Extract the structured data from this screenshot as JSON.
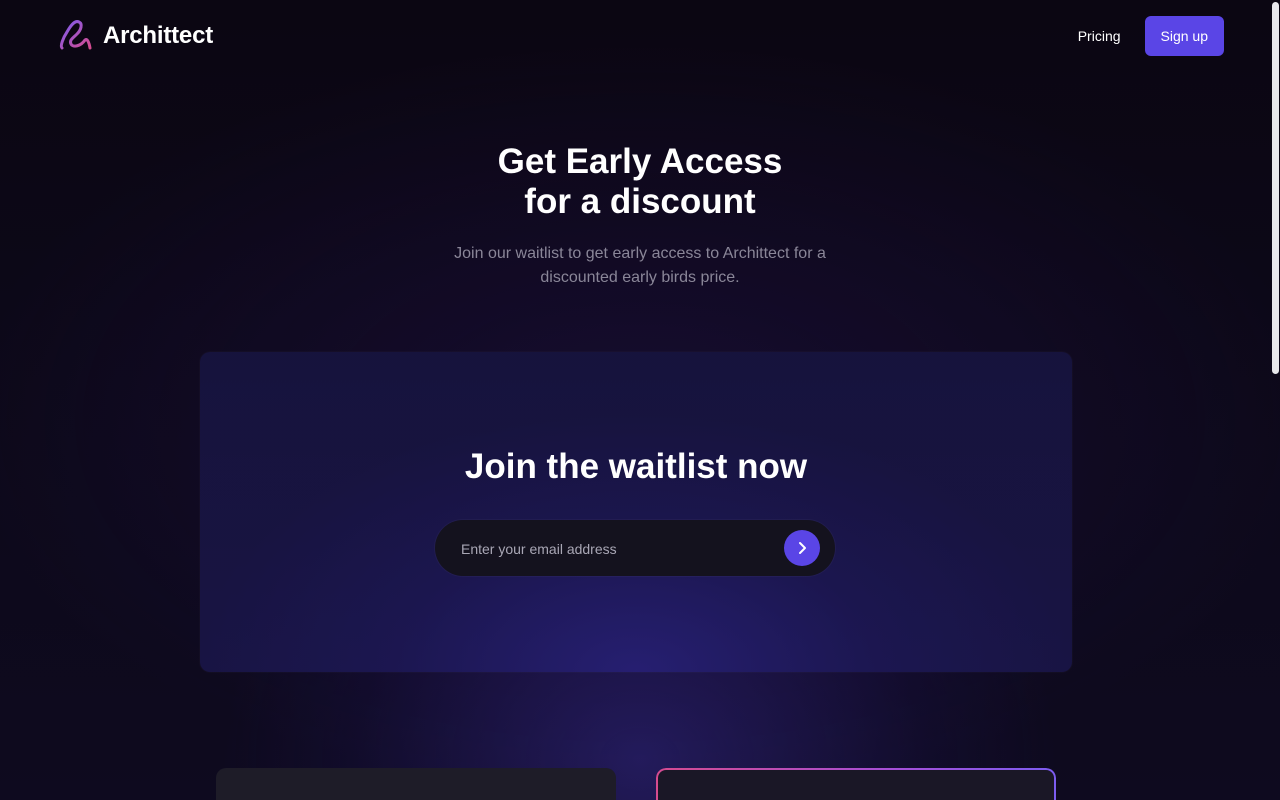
{
  "header": {
    "brand_name": "Archittect",
    "nav": {
      "pricing_label": "Pricing",
      "signup_label": "Sign up"
    }
  },
  "hero": {
    "title_line1": "Get Early Access",
    "title_line2": "for a discount",
    "subtitle": "Join our waitlist to get early access to Archittect for a discounted early birds price."
  },
  "waitlist": {
    "title": "Join the waitlist now",
    "email_placeholder": "Enter your email address",
    "submit_icon": "chevron-right-icon"
  },
  "colors": {
    "accent": "#5a45e6",
    "background": "#0c0818",
    "logo_gradient_start": "#7c5cf0",
    "logo_gradient_end": "#d64b8f"
  }
}
